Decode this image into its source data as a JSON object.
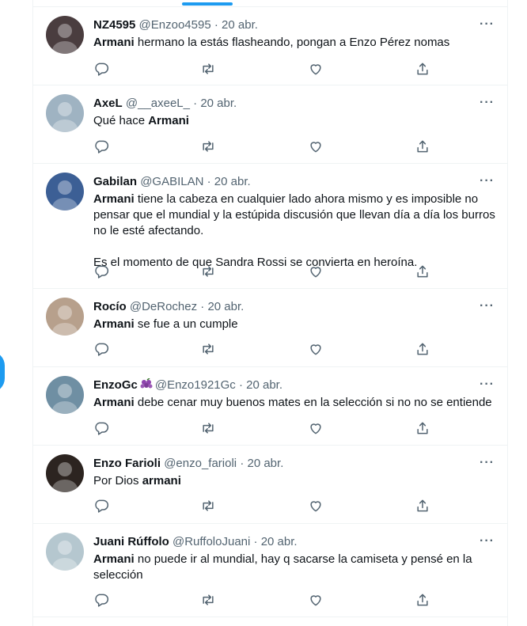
{
  "tweets": [
    {
      "name": "NZ4595",
      "handle": "@Enzoo4595",
      "date": "20 abr.",
      "body": [
        {
          "t": "Armani",
          "b": true
        },
        {
          "t": " hermano la estás flasheando, pongan a Enzo Pérez nomas",
          "b": false
        }
      ],
      "avatar_color": "#4a3d3f"
    },
    {
      "name": "AxeL",
      "handle": "@__axeeL_",
      "date": "20 abr.",
      "body": [
        {
          "t": "Qué hace ",
          "b": false
        },
        {
          "t": "Armani",
          "b": true
        }
      ],
      "avatar_color": "#9fb3c2"
    },
    {
      "name": "Gabilan",
      "handle": "@GABILAN",
      "date": "20 abr.",
      "body": [
        {
          "t": "Armani",
          "b": true
        },
        {
          "t": " tiene la cabeza en cualquier lado ahora mismo y es imposible no pensar que el mundial y la estúpida discusión que llevan día a día los burros no le esté afectando.",
          "b": false
        },
        {
          "t": "\nEs el momento de que Sandra Rossi se convierta en heroína.",
          "b": false
        }
      ],
      "avatar_color": "#3c5f95"
    },
    {
      "name": "Rocío",
      "handle": "@DeRochez",
      "date": "20 abr.",
      "body": [
        {
          "t": "Armani",
          "b": true
        },
        {
          "t": " se fue a un cumple",
          "b": false
        }
      ],
      "avatar_color": "#b7a08c"
    },
    {
      "name": "EnzoGc",
      "handle": "@Enzo1921Gc",
      "date": "20 abr.",
      "emoji": "grapes-icon",
      "body": [
        {
          "t": "Armani",
          "b": true
        },
        {
          "t": " debe cenar muy buenos mates en la selección si no no se entiende",
          "b": false
        }
      ],
      "avatar_color": "#6f8fa3"
    },
    {
      "name": "Enzo Farioli",
      "handle": "@enzo_farioli",
      "date": "20 abr.",
      "body": [
        {
          "t": "Por Dios ",
          "b": false
        },
        {
          "t": "armani",
          "b": true
        }
      ],
      "avatar_color": "#2c2420"
    },
    {
      "name": "Juani Rúffolo",
      "handle": "@RuffoloJuani",
      "date": "20 abr.",
      "body": [
        {
          "t": "Armani",
          "b": true
        },
        {
          "t": " no puede ir al mundial, hay q sacarse la camiseta y pensé en la selección",
          "b": false
        }
      ],
      "avatar_color": "#b5c7cf"
    }
  ],
  "header_separator": "·",
  "more_label": "···",
  "colors": {
    "accent": "#1d9bf0",
    "secondary_text": "#536471",
    "border": "#eff3f4"
  },
  "action_icons": [
    "reply-icon",
    "retweet-icon",
    "like-icon",
    "share-icon"
  ]
}
